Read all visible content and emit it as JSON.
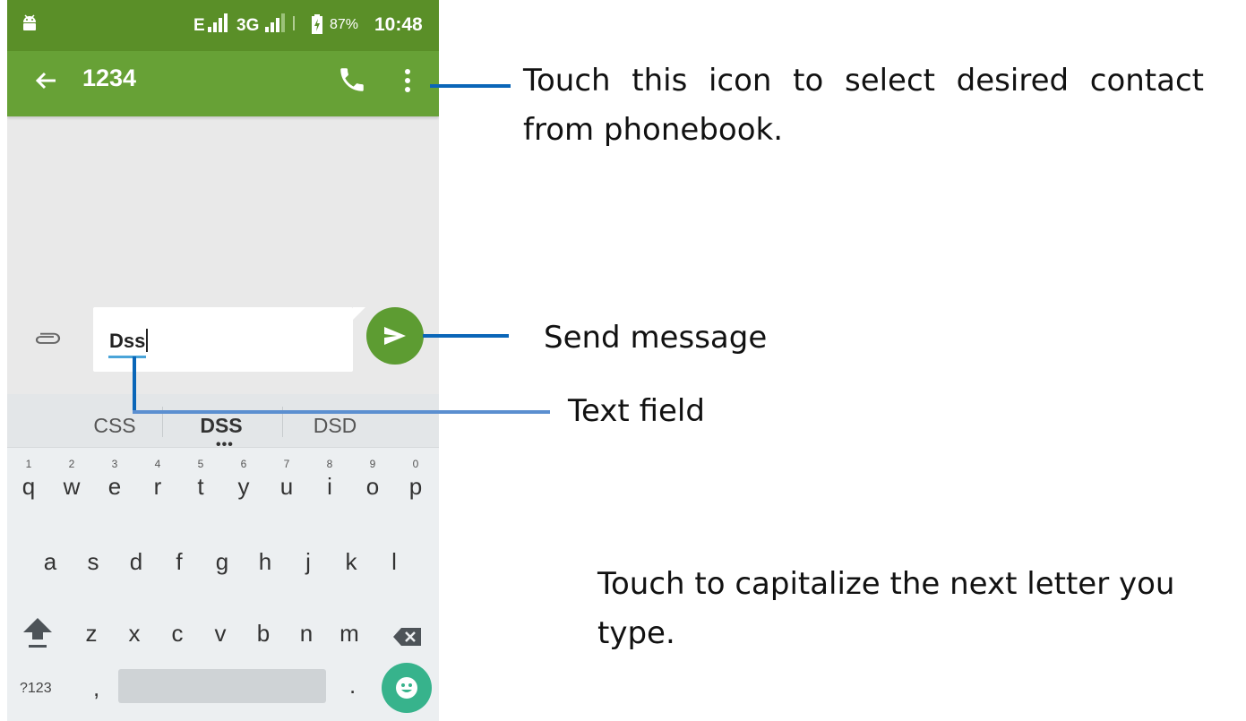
{
  "status_bar": {
    "android_icon": "android-icon",
    "network_e": "E",
    "network_3g": "3G",
    "battery_percent": "87%",
    "time": "10:48"
  },
  "app_bar": {
    "title": "1234",
    "back_icon": "arrow-back-icon",
    "call_icon": "phone-icon",
    "more_icon": "more-vertical-icon",
    "color": "#67a136"
  },
  "compose": {
    "attach_icon": "paperclip-icon",
    "text_value": "Dss",
    "send_icon": "send-icon",
    "send_color": "#5d9c32"
  },
  "keyboard": {
    "suggestions": [
      "CSS",
      "DSS",
      "DSD"
    ],
    "row1": [
      {
        "letter": "q",
        "hint": "1"
      },
      {
        "letter": "w",
        "hint": "2"
      },
      {
        "letter": "e",
        "hint": "3"
      },
      {
        "letter": "r",
        "hint": "4"
      },
      {
        "letter": "t",
        "hint": "5"
      },
      {
        "letter": "y",
        "hint": "6"
      },
      {
        "letter": "u",
        "hint": "7"
      },
      {
        "letter": "i",
        "hint": "8"
      },
      {
        "letter": "o",
        "hint": "9"
      },
      {
        "letter": "p",
        "hint": "0"
      }
    ],
    "row2": [
      "a",
      "s",
      "d",
      "f",
      "g",
      "h",
      "j",
      "k",
      "l"
    ],
    "row3": [
      "z",
      "x",
      "c",
      "v",
      "b",
      "n",
      "m"
    ],
    "symbols_label": "?123",
    "comma": ",",
    "period": ".",
    "shift_icon": "shift-icon",
    "delete_icon": "backspace-icon",
    "emoji_icon": "emoji-icon",
    "emoji_color": "#37b38c"
  },
  "annotations": {
    "contact": "Touch this icon to select desired contact from phonebook.",
    "send": "Send message",
    "text_field": "Text field",
    "capitalize": "Touch to capitalize the next letter you type.",
    "line_color": "#0a66b8"
  }
}
